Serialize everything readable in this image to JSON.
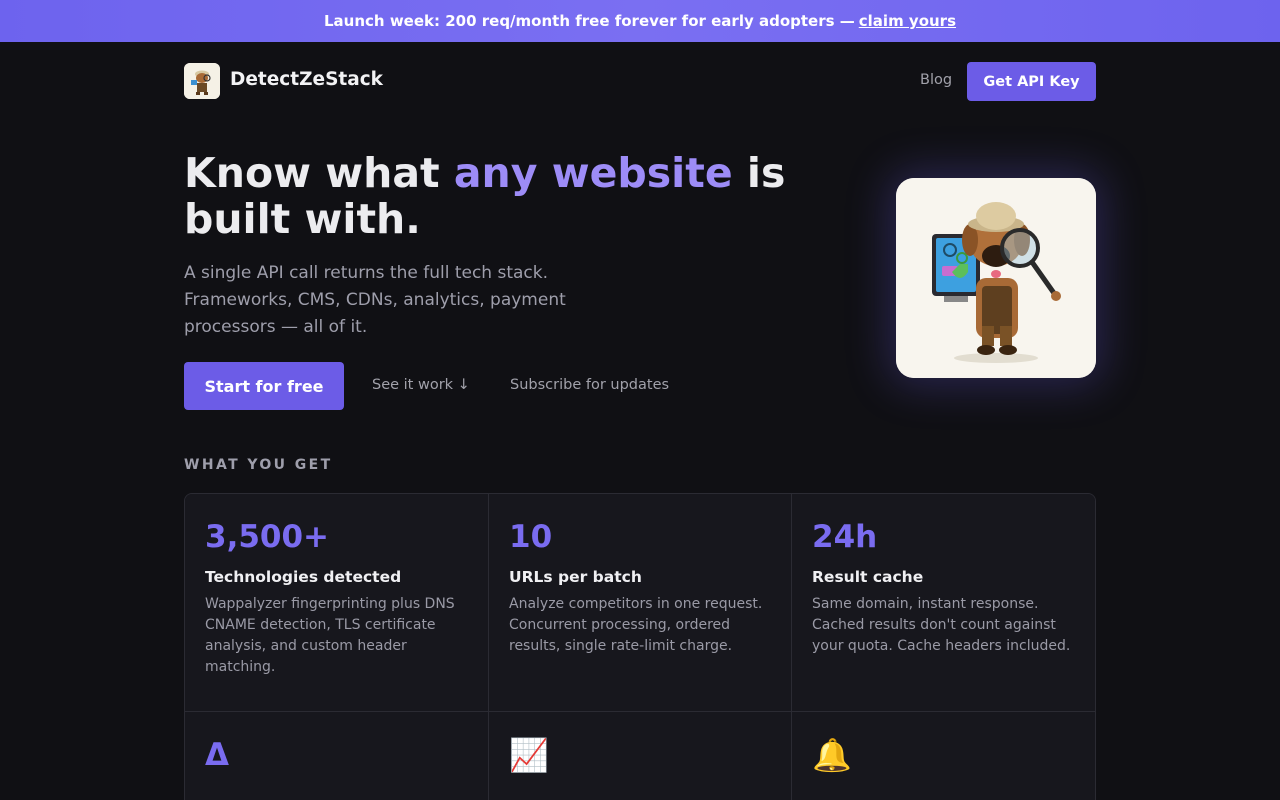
{
  "banner": {
    "text": "Launch week: 200 req/month free forever for early adopters —",
    "link": "claim yours"
  },
  "nav": {
    "brand": "DetectZeStack",
    "blog": "Blog",
    "cta": "Get API Key"
  },
  "hero": {
    "title_part1": "Know what ",
    "title_accent": "any website",
    "title_part2": " is built with.",
    "subtitle": "A single API call returns the full tech stack. Frameworks, CMS, CDNs, analytics, payment processors — all of it.",
    "primary_cta": "Start for free",
    "secondary_link": "See it work ↓",
    "tertiary_link": "Subscribe for updates"
  },
  "features": {
    "label": "WHAT YOU GET",
    "cards": [
      {
        "stat": "3,500+",
        "title": "Technologies detected",
        "desc": "Wappalyzer fingerprinting plus DNS CNAME detection, TLS certificate analysis, and custom header matching."
      },
      {
        "stat": "10",
        "title": "URLs per batch",
        "desc": "Analyze competitors in one request. Concurrent processing, ordered results, single rate-limit charge."
      },
      {
        "stat": "24h",
        "title": "Result cache",
        "desc": "Same domain, instant response. Cached results don't count against your quota. Cache headers included."
      },
      {
        "stat": "Δ",
        "title": "",
        "desc": ""
      },
      {
        "stat": "📈",
        "title": "",
        "desc": ""
      },
      {
        "stat": "🔔",
        "title": "",
        "desc": ""
      }
    ]
  },
  "colors": {
    "accent": "#6c5ce7",
    "accent_text": "#9d8cf7",
    "background": "#101014",
    "card": "#17171d"
  }
}
